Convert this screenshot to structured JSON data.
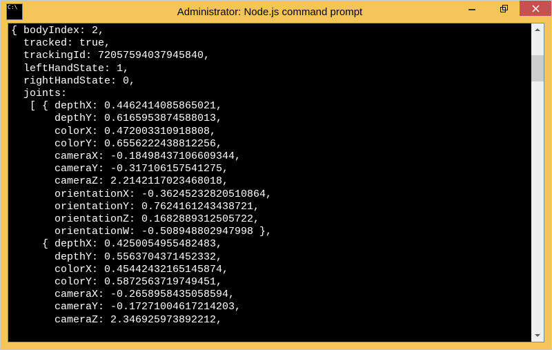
{
  "window": {
    "title": "Administrator: Node.js command prompt",
    "icon_name": "cmd-prompt-icon"
  },
  "controls": {
    "minimize_glyph": "minimize",
    "maximize_glyph": "maximize",
    "close_glyph": "close"
  },
  "console": {
    "header": {
      "bodyIndex": 2,
      "tracked": "true",
      "trackingId": "72057594037945840",
      "leftHandState": 1,
      "rightHandState": 0
    },
    "joints": [
      {
        "depthX": "0.4462414085865021",
        "depthY": "0.6165953874588013",
        "colorX": "0.472003310918808",
        "colorY": "0.6556222438812256",
        "cameraX": "-0.18498437106609344",
        "cameraY": "-0.317106157541275",
        "cameraZ": "2.2142117023468018",
        "orientationX": "-0.36245232820510864",
        "orientationY": "0.7624161243438721",
        "orientationZ": "0.1682889312505722",
        "orientationW": "-0.508948802947998"
      },
      {
        "depthX": "0.4250054955482483",
        "depthY": "0.5563704371452332",
        "colorX": "0.45442432165145874",
        "colorY": "0.5872563719749451",
        "cameraX": "-0.2658958435058594",
        "cameraY": "-0.17271004617214203",
        "cameraZ": "2.346925973892212"
      }
    ]
  }
}
